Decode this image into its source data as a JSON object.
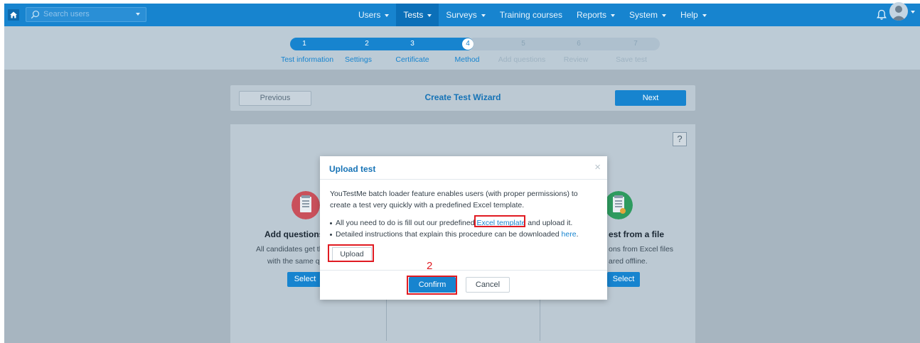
{
  "header": {
    "search_placeholder": "Search users",
    "nav": [
      {
        "label": "Users",
        "caret": true,
        "active": false
      },
      {
        "label": "Tests",
        "caret": true,
        "active": true
      },
      {
        "label": "Surveys",
        "caret": true,
        "active": false
      },
      {
        "label": "Training courses",
        "caret": false,
        "active": false
      },
      {
        "label": "Reports",
        "caret": true,
        "active": false
      },
      {
        "label": "System",
        "caret": true,
        "active": false
      },
      {
        "label": "Help",
        "caret": true,
        "active": false
      }
    ],
    "colors": {
      "nav_bg": "#1784cf",
      "nav_active": "#0b6fb8"
    }
  },
  "stepper": {
    "current": 4,
    "steps": [
      {
        "num": "1",
        "label": "Test information"
      },
      {
        "num": "2",
        "label": "Settings"
      },
      {
        "num": "3",
        "label": "Certificate"
      },
      {
        "num": "4",
        "label": "Method"
      },
      {
        "num": "5",
        "label": "Add questions"
      },
      {
        "num": "6",
        "label": "Review"
      },
      {
        "num": "7",
        "label": "Save test"
      }
    ]
  },
  "wizard": {
    "previous_label": "Previous",
    "title": "Create Test Wizard",
    "next_label": "Next",
    "help_label": "?"
  },
  "options": {
    "left": {
      "title": "Add questions",
      "desc1": "All candidates get th",
      "desc2": "with the same q",
      "button": "Select"
    },
    "right": {
      "title": "est from a file",
      "desc1": "ons from Excel files",
      "desc2": "ared offline.",
      "button": "Select"
    }
  },
  "modal": {
    "title": "Upload test",
    "close": "×",
    "intro": "YouTestMe batch loader feature enables users (with proper permissions) to create a test very quickly with a predefined Excel template.",
    "bullet1_pre": "All you need to do is fill out our predefined ",
    "bullet1_link": "Excel template",
    "bullet1_post": " and upload it.",
    "bullet2_pre": "Detailed instructions that explain this procedure can be downloaded ",
    "bullet2_link": "here",
    "bullet2_post": ".",
    "upload_label": "Upload",
    "confirm_label": "Confirm",
    "cancel_label": "Cancel"
  },
  "annotation": {
    "step_marker": "2",
    "color": "#e01b22"
  }
}
